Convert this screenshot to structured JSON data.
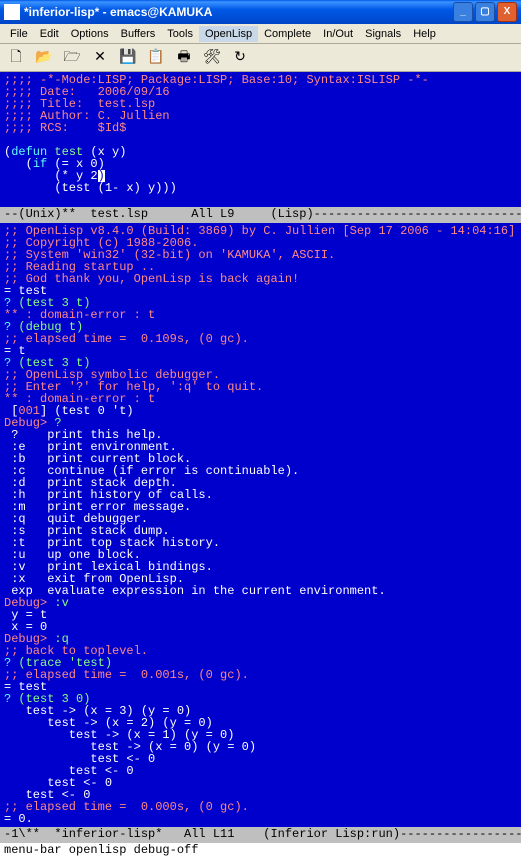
{
  "titlebar": {
    "title": "*inferior-lisp* - emacs@KAMUKA"
  },
  "menubar": {
    "items": [
      "File",
      "Edit",
      "Options",
      "Buffers",
      "Tools",
      "OpenLisp",
      "Complete",
      "In/Out",
      "Signals",
      "Help"
    ],
    "active_index": 5
  },
  "toolbar": {
    "icons": [
      "new-file-icon",
      "open-file-icon",
      "folder-icon",
      "close-icon",
      "save-icon",
      "copy-icon",
      "print-icon",
      "settings-icon",
      "refresh-icon"
    ]
  },
  "top_editor": {
    "lines": [
      {
        "t": ";;;; -*-Mode:LISP; Package:LISP; Base:10; Syntax:ISLISP -*-",
        "cls": "c-comment"
      },
      {
        "t": ";;;; Date:   2006/09/16",
        "cls": "c-comment"
      },
      {
        "t": ";;;; Title:  test.lsp",
        "cls": "c-comment"
      },
      {
        "t": ";;;; Author: C. Jullien",
        "cls": "c-comment"
      },
      {
        "t": ";;;; RCS:    $Id$",
        "cls": "c-comment"
      },
      {
        "t": "",
        "cls": ""
      },
      {
        "segs": [
          {
            "t": "(",
            "cls": ""
          },
          {
            "t": "defun",
            "cls": "c-keyword"
          },
          {
            "t": " ",
            "cls": ""
          },
          {
            "t": "test",
            "cls": "c-func"
          },
          {
            "t": " (x y)",
            "cls": ""
          }
        ]
      },
      {
        "segs": [
          {
            "t": "   (",
            "cls": ""
          },
          {
            "t": "if",
            "cls": "c-keyword"
          },
          {
            "t": " (= x 0)",
            "cls": ""
          }
        ]
      },
      {
        "segs": [
          {
            "t": "       (* y 2",
            "cls": ""
          },
          {
            "t": ")",
            "cls": "",
            "cursor": true
          }
        ]
      },
      {
        "t": "       (test (1- x) y)))",
        "cls": ""
      }
    ]
  },
  "modeline_top": "--(Unix)**  test.lsp      All L9     (Lisp)------------------------------------",
  "bottom_editor": {
    "lines": [
      {
        "t": ";; OpenLisp v8.4.0 (Build: 3869) by C. Jullien [Sep 17 2006 - 14:04:16]",
        "cls": "c-comment"
      },
      {
        "t": ";; Copyright (c) 1988-2006.",
        "cls": "c-comment"
      },
      {
        "t": ";; System 'win32' (32-bit) on 'KAMUKA', ASCII.",
        "cls": "c-comment"
      },
      {
        "t": ";; Reading startup ..",
        "cls": "c-comment"
      },
      {
        "t": ";; God thank you, OpenLisp is back again!",
        "cls": "c-comment"
      },
      {
        "t": "= test",
        "cls": ""
      },
      {
        "segs": [
          {
            "t": "?",
            "cls": "c-prompt"
          },
          {
            "t": " (test 3 t)",
            "cls": "c-func"
          }
        ]
      },
      {
        "t": "** : domain-error : t",
        "cls": "c-comment"
      },
      {
        "segs": [
          {
            "t": "?",
            "cls": "c-prompt"
          },
          {
            "t": " (debug t)",
            "cls": "c-func"
          }
        ]
      },
      {
        "t": ";; elapsed time =  0.109s, (0 gc).",
        "cls": "c-comment"
      },
      {
        "t": "= t",
        "cls": ""
      },
      {
        "segs": [
          {
            "t": "?",
            "cls": "c-prompt"
          },
          {
            "t": " (test 3 t)",
            "cls": "c-func"
          }
        ]
      },
      {
        "t": ";; OpenLisp symbolic debugger.",
        "cls": "c-comment"
      },
      {
        "t": ";; Enter '?' for help, ':q' to quit.",
        "cls": "c-comment"
      },
      {
        "t": "** : domain-error : t",
        "cls": "c-comment"
      },
      {
        "segs": [
          {
            "t": " [",
            "cls": ""
          },
          {
            "t": "001",
            "cls": "c-debug"
          },
          {
            "t": "] (test 0 't)",
            "cls": ""
          }
        ]
      },
      {
        "segs": [
          {
            "t": "Debug>",
            "cls": "c-debug"
          },
          {
            "t": " ?",
            "cls": "c-func"
          }
        ]
      },
      {
        "t": " ?    print this help.",
        "cls": ""
      },
      {
        "t": " :e   print environment.",
        "cls": ""
      },
      {
        "t": " :b   print current block.",
        "cls": ""
      },
      {
        "t": " :c   continue (if error is continuable).",
        "cls": ""
      },
      {
        "t": " :d   print stack depth.",
        "cls": ""
      },
      {
        "t": " :h   print history of calls.",
        "cls": ""
      },
      {
        "t": " :m   print error message.",
        "cls": ""
      },
      {
        "t": " :q   quit debugger.",
        "cls": ""
      },
      {
        "t": " :s   print stack dump.",
        "cls": ""
      },
      {
        "t": " :t   print top stack history.",
        "cls": ""
      },
      {
        "t": " :u   up one block.",
        "cls": ""
      },
      {
        "t": " :v   print lexical bindings.",
        "cls": ""
      },
      {
        "t": " :x   exit from OpenLisp.",
        "cls": ""
      },
      {
        "t": " exp  evaluate expression in the current environment.",
        "cls": ""
      },
      {
        "segs": [
          {
            "t": "Debug>",
            "cls": "c-debug"
          },
          {
            "t": " :v",
            "cls": "c-func"
          }
        ]
      },
      {
        "t": " y = t",
        "cls": ""
      },
      {
        "t": " x = 0",
        "cls": ""
      },
      {
        "segs": [
          {
            "t": "Debug>",
            "cls": "c-debug"
          },
          {
            "t": " :q",
            "cls": "c-func"
          }
        ]
      },
      {
        "t": ";; back to toplevel.",
        "cls": "c-comment"
      },
      {
        "segs": [
          {
            "t": "?",
            "cls": "c-prompt"
          },
          {
            "t": " (trace 'test)",
            "cls": "c-func"
          }
        ]
      },
      {
        "t": ";; elapsed time =  0.001s, (0 gc).",
        "cls": "c-comment"
      },
      {
        "t": "= test",
        "cls": ""
      },
      {
        "segs": [
          {
            "t": "?",
            "cls": "c-prompt"
          },
          {
            "t": " (test 3 0)",
            "cls": "c-func"
          }
        ]
      },
      {
        "t": "   test -> (x = 3) (y = 0)",
        "cls": ""
      },
      {
        "t": "      test -> (x = 2) (y = 0)",
        "cls": ""
      },
      {
        "t": "         test -> (x = 1) (y = 0)",
        "cls": ""
      },
      {
        "t": "            test -> (x = 0) (y = 0)",
        "cls": ""
      },
      {
        "t": "            test <- 0",
        "cls": ""
      },
      {
        "t": "         test <- 0",
        "cls": ""
      },
      {
        "t": "      test <- 0",
        "cls": ""
      },
      {
        "t": "   test <- 0",
        "cls": ""
      },
      {
        "t": ";; elapsed time =  0.000s, (0 gc).",
        "cls": "c-comment"
      },
      {
        "t": "= 0.",
        "cls": ""
      }
    ]
  },
  "modeline_bottom": "-1\\**  *inferior-lisp*   All L11    (Inferior Lisp:run)-------------------------",
  "minibuffer": "menu-bar openlisp debug-off"
}
